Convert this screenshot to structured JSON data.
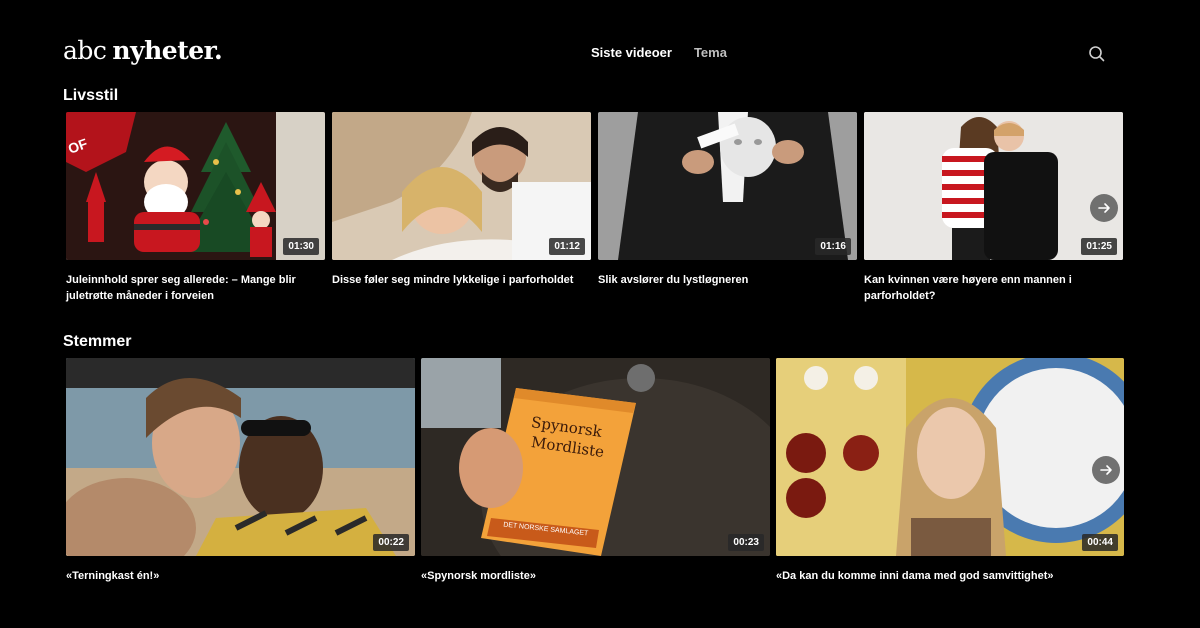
{
  "header": {
    "logo_light": "abc",
    "logo_bold": "nyheter.",
    "nav": [
      "Siste videoer",
      "Tema"
    ]
  },
  "sections": [
    {
      "title": "Livsstil",
      "cards": [
        {
          "duration": "01:30",
          "caption": "Juleinnhold sprer seg allerede: – Mange blir juletrøtte måneder i forveien"
        },
        {
          "duration": "01:12",
          "caption": "Disse føler seg mindre lykkelige i parforholdet"
        },
        {
          "duration": "01:16",
          "caption": "Slik avslører du lystløgneren"
        },
        {
          "duration": "01:25",
          "caption": "Kan kvinnen være høyere enn mannen i parforholdet?"
        }
      ]
    },
    {
      "title": "Stemmer",
      "cards": [
        {
          "duration": "00:22",
          "caption": "«Terningkast én!»"
        },
        {
          "duration": "00:23",
          "caption": "«Spynorsk mordliste»"
        },
        {
          "duration": "00:44",
          "caption": "«Da kan du komme inni dama med god samvittighet»"
        }
      ]
    }
  ],
  "thumb_text": {
    "book_line1": "Spynorsk",
    "book_line2": "Mordliste",
    "book_footer": "DET NORSKE SAMLAGET",
    "sign_letters": "OF"
  }
}
